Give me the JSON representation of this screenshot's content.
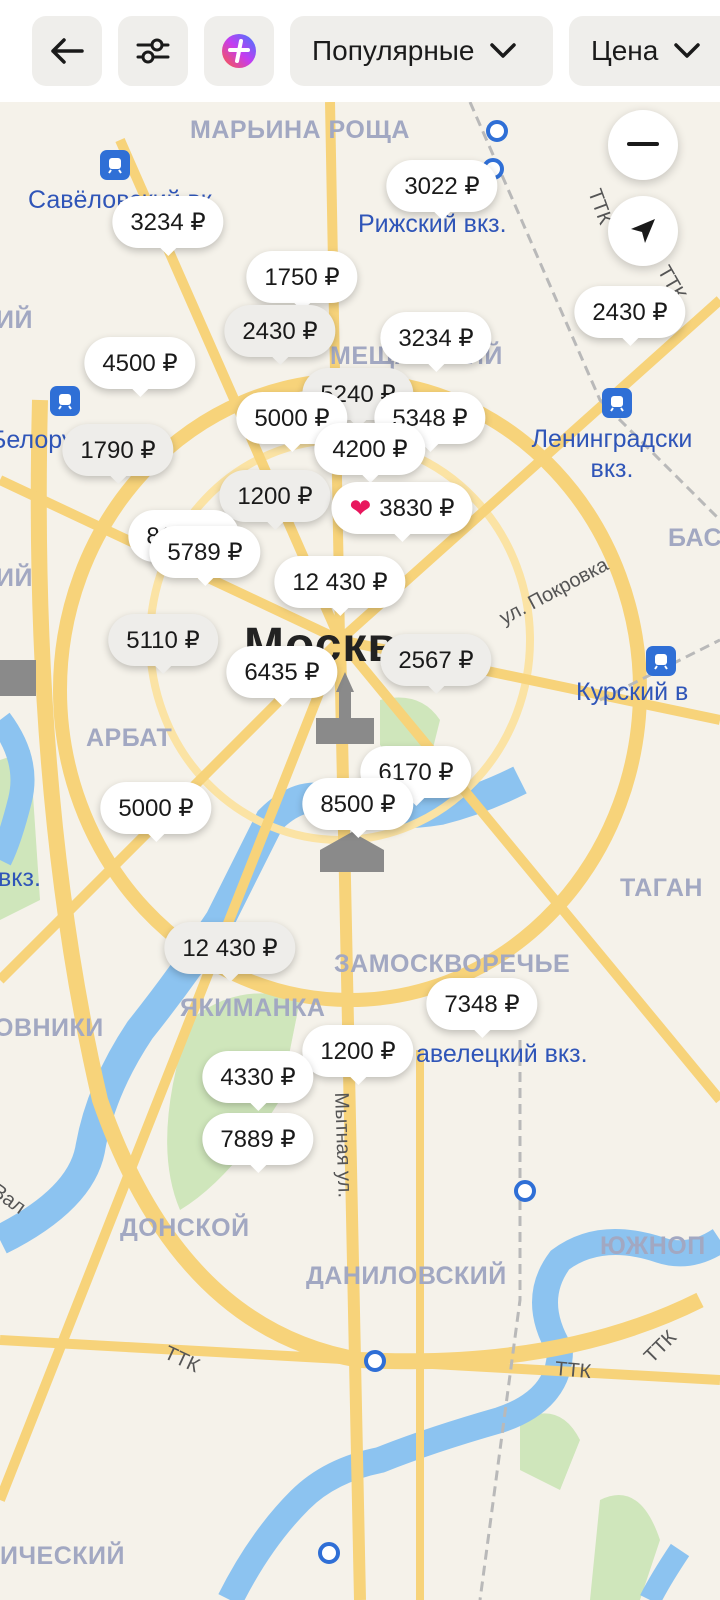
{
  "header": {
    "sort_label": "Популярные",
    "price_label": "Цена",
    "back_icon": "arrow-left-icon",
    "filters_icon": "sliders-icon",
    "plus_icon": "plus-logo-icon"
  },
  "map": {
    "city_label": "Москва",
    "districts": [
      "МАРЬИНА РОЩА",
      "МЕЩАНСКИЙ",
      "БАСМ",
      "АРБАТ",
      "ТАГАН",
      "ЗАМОСКВОРЕЧЬЕ",
      "ЯКИМАНКА",
      "ОВНИКИ",
      "ДОНСКОЙ",
      "ДАНИЛОВСКИЙ",
      "ЮЖНОП",
      "ИЧЕСКИЙ",
      "ИЙ",
      "ИЙ"
    ],
    "stations": [
      "Савёловский вк",
      "Рижский вкз.",
      "Ленинградски вкз.",
      "Белору вкз",
      "Курский в",
      "вкз.",
      "авелецкий вкз."
    ],
    "streets": [
      "ул. Покровка",
      "Мытная ул.",
      "Вал",
      "ТТК",
      "ТТК",
      "ТТК",
      "ТТК",
      "ТТК"
    ],
    "accent_color": "#e8175d",
    "metro_color": "#2f6fd6"
  },
  "prices": [
    {
      "label": "3022 ₽"
    },
    {
      "label": "3234 ₽"
    },
    {
      "label": "1750 ₽"
    },
    {
      "label": "2430 ₽"
    },
    {
      "label": "3234 ₽"
    },
    {
      "label": "2430 ₽"
    },
    {
      "label": "4500 ₽"
    },
    {
      "label": "5240 ₽"
    },
    {
      "label": "5000 ₽"
    },
    {
      "label": "5348 ₽"
    },
    {
      "label": "1790 ₽"
    },
    {
      "label": "4200 ₽"
    },
    {
      "label": "1200 ₽"
    },
    {
      "label": "3830 ₽",
      "favorite": true
    },
    {
      "label": "8100 ₽"
    },
    {
      "label": "5789 ₽"
    },
    {
      "label": "12 430 ₽"
    },
    {
      "label": "5110 ₽"
    },
    {
      "label": "6435 ₽"
    },
    {
      "label": "2567 ₽"
    },
    {
      "label": "6170 ₽"
    },
    {
      "label": "8500 ₽"
    },
    {
      "label": "5000 ₽"
    },
    {
      "label": "12 430 ₽"
    },
    {
      "label": "7348 ₽"
    },
    {
      "label": "1200 ₽"
    },
    {
      "label": "4330 ₽"
    },
    {
      "label": "7889 ₽"
    }
  ],
  "controls": {
    "zoom_out_icon": "minus-icon",
    "locate_icon": "location-arrow-icon"
  }
}
